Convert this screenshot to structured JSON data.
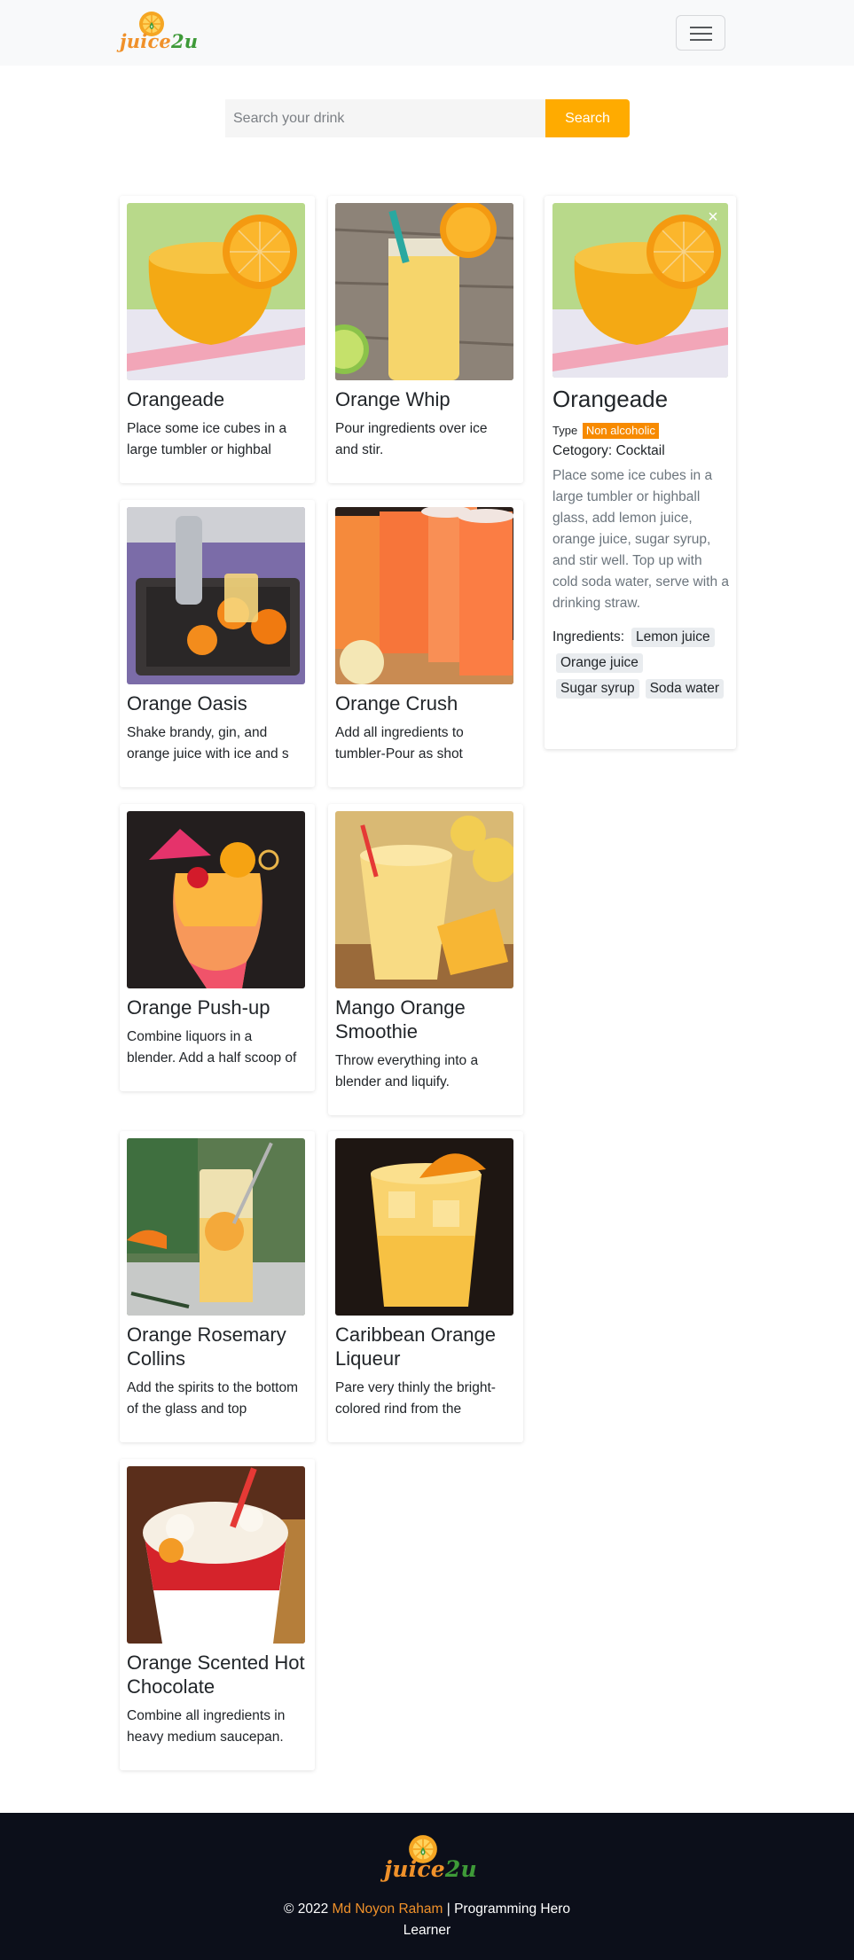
{
  "navbar": {
    "brand": "juice2u",
    "brand_main": "juice",
    "brand_accent": "2u",
    "menu_icon": "hamburger-icon"
  },
  "search": {
    "placeholder": "Search your drink",
    "value": "",
    "button_label": "Search"
  },
  "drinks": [
    {
      "name": "Orangeade",
      "description": "Place some ice cubes in a large tumbler or highbal"
    },
    {
      "name": "Orange Whip",
      "description": "Pour ingredients over ice and stir."
    },
    {
      "name": "Orange Oasis",
      "description": "Shake brandy, gin, and orange juice with ice and s"
    },
    {
      "name": "Orange Crush",
      "description": "Add all ingredients to tumbler-Pour as shot"
    },
    {
      "name": "Orange Push-up",
      "description": "Combine liquors in a blender. Add a half scoop of"
    },
    {
      "name": "Mango Orange Smoothie",
      "description": "Throw everything into a blender and liquify."
    },
    {
      "name": "Orange Rosemary Collins",
      "description": "Add the spirits to the bottom of the glass and top"
    },
    {
      "name": "Caribbean Orange Liqueur",
      "description": "Pare very thinly the bright-colored rind from the"
    },
    {
      "name": "Orange Scented Hot Chocolate",
      "description": "Combine all ingredients in heavy medium saucepan."
    }
  ],
  "detail": {
    "close_label": "×",
    "name": "Orangeade",
    "type_label": "Type",
    "type_value": "Non alcoholic",
    "category_text": "Cetogory: Cocktail",
    "instructions": "Place some ice cubes in a large tumbler or highball glass, add lemon juice, orange juice, sugar syrup, and stir well. Top up with cold soda water, serve with a drinking straw.",
    "ingredients_label": "Ingredients:",
    "ingredients": [
      "Lemon juice",
      "Orange juice",
      "Sugar syrup",
      "Soda water"
    ]
  },
  "footer": {
    "copyright_prefix": "© 2022",
    "author": "Md Noyon Raham",
    "suffix": "| Programming Hero Learner"
  },
  "colors": {
    "accent": "#ffab00",
    "badge": "#f78a00",
    "brand_orange": "#f0912a",
    "brand_green": "#3e9a38",
    "footer_bg": "#0c0f1a"
  }
}
